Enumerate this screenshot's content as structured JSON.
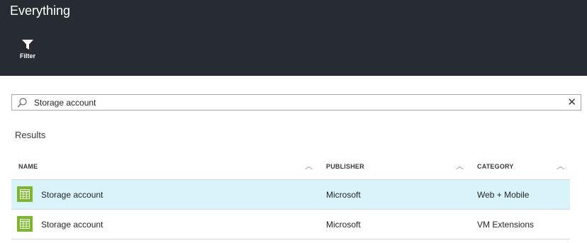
{
  "header": {
    "title": "Everything",
    "filter_label": "Filter",
    "background": "#272c32"
  },
  "search": {
    "value": "Storage account",
    "icon": "search-icon",
    "clear_icon": "close-icon"
  },
  "results": {
    "heading": "Results",
    "columns": [
      {
        "label": "NAME"
      },
      {
        "label": "PUBLISHER"
      },
      {
        "label": "CATEGORY"
      }
    ],
    "rows": [
      {
        "name": "Storage account",
        "publisher": "Microsoft",
        "category": "Web + Mobile",
        "selected": true,
        "icon": "storage-grid-icon"
      },
      {
        "name": "Storage account",
        "publisher": "Microsoft",
        "category": "VM Extensions",
        "selected": false,
        "icon": "storage-grid-icon"
      }
    ],
    "icon_color": "#7ab829",
    "selected_row_color": "#d9f3fa"
  }
}
